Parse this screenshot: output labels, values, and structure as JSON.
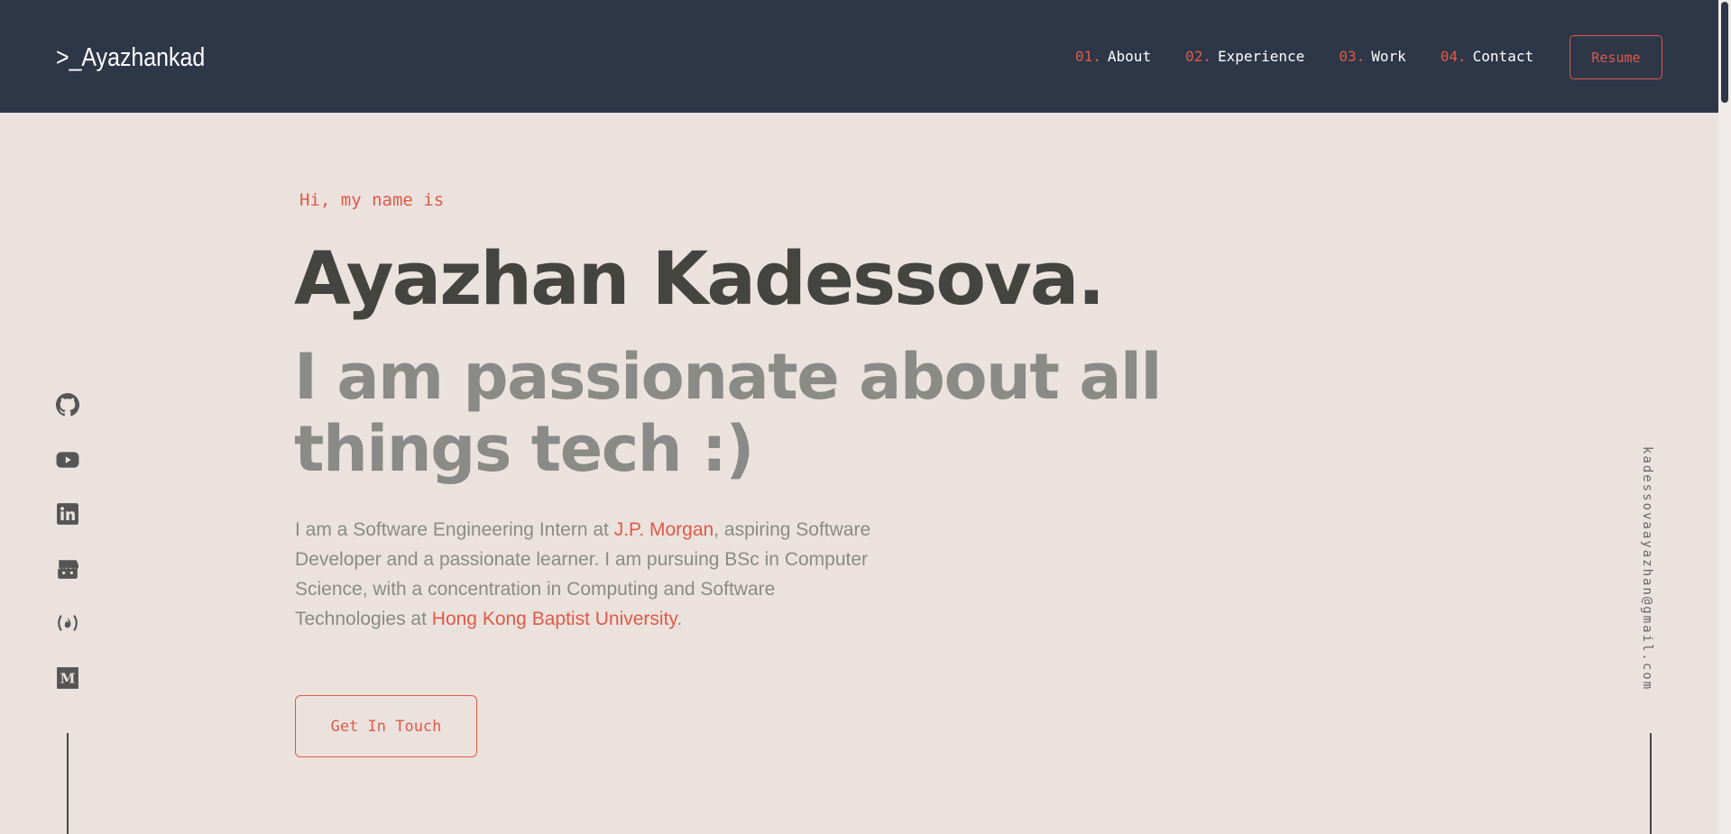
{
  "header": {
    "logo": ">_Ayazhankad",
    "nav": [
      {
        "num": "01.",
        "label": "About"
      },
      {
        "num": "02.",
        "label": "Experience"
      },
      {
        "num": "03.",
        "label": "Work"
      },
      {
        "num": "04.",
        "label": "Contact"
      }
    ],
    "resume_label": "Resume"
  },
  "hero": {
    "greeting": "Hi, my name is",
    "name": "Ayazhan Kadessova.",
    "tagline": "I am passionate about all things tech :)",
    "bio": {
      "part1": "I am a Software Engineering Intern at ",
      "link1": "J.P. Morgan",
      "part2": ", aspiring Software Developer and a passionate learner. I am pursuing BSc in Computer Science, with a concentration in Computing and Software Technologies at ",
      "link2": "Hong Kong Baptist University",
      "part3": "."
    },
    "cta_label": "Get In Touch"
  },
  "social": [
    "github-icon",
    "youtube-icon",
    "linkedin-icon",
    "itchio-icon",
    "freecodecamp-icon",
    "medium-icon"
  ],
  "email": "kadessovaayazhan@gmail.com",
  "colors": {
    "header_bg": "#2d3748",
    "page_bg": "#ebe2de",
    "accent": "#e05a47",
    "name": "#444441",
    "muted": "#8a8a86"
  }
}
